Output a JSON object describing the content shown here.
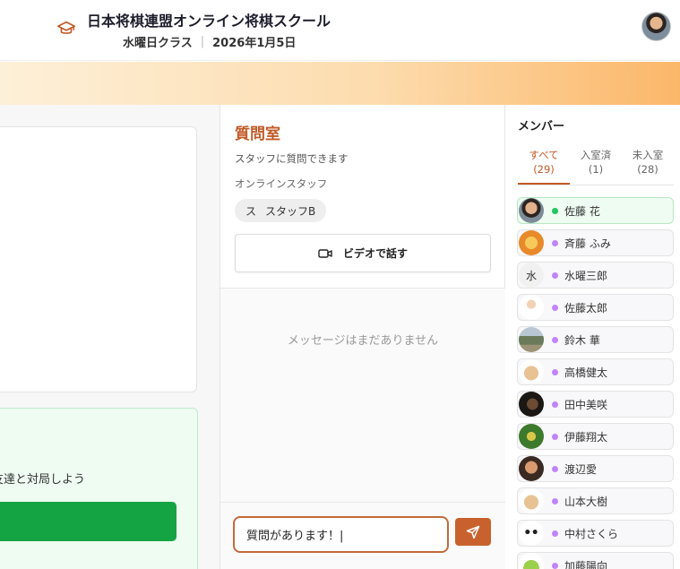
{
  "header": {
    "title": "日本将棋連盟オンライン将棋スクール",
    "class_name": "水曜日クラス",
    "separator": "|",
    "date": "2026年1月5日",
    "icon": "graduation-cap-icon",
    "accent": "#c25a26"
  },
  "left": {
    "green_text": "友達と対局しよう"
  },
  "question_room": {
    "title": "質問室",
    "description": "スタッフに質問できます",
    "online_staff_label": "オンラインスタッフ",
    "staff": [
      {
        "initial": "ス",
        "name": "スタッフB"
      }
    ],
    "video_button_label": "ビデオで話す",
    "empty_message": "メッセージはまだありません",
    "input_value": "質問があります！|",
    "send_icon": "send-icon"
  },
  "members": {
    "title": "メンバー",
    "tabs": [
      {
        "label": "すべて",
        "count": "(29)",
        "active": true
      },
      {
        "label": "入室済",
        "count": "(1)",
        "active": false
      },
      {
        "label": "未入室",
        "count": "(28)",
        "active": false
      }
    ],
    "status_colors": {
      "online": "#22c55e",
      "offline": "#c084fc"
    },
    "list": [
      {
        "name": "佐藤 花",
        "online": true,
        "avatar": "photo-woman",
        "initial": ""
      },
      {
        "name": "斉藤 ふみ",
        "online": false,
        "avatar": "lion",
        "initial": ""
      },
      {
        "name": "水曜三郎",
        "online": false,
        "avatar": "initial",
        "initial": "水"
      },
      {
        "name": "佐藤太郎",
        "online": false,
        "avatar": "doctor",
        "initial": ""
      },
      {
        "name": "鈴木 華",
        "online": false,
        "avatar": "landscape",
        "initial": ""
      },
      {
        "name": "高橋健太",
        "online": false,
        "avatar": "bear",
        "initial": ""
      },
      {
        "name": "田中美咲",
        "online": false,
        "avatar": "dark-photo",
        "initial": ""
      },
      {
        "name": "伊藤翔太",
        "online": false,
        "avatar": "green-photo",
        "initial": ""
      },
      {
        "name": "渡辺愛",
        "online": false,
        "avatar": "man-photo",
        "initial": ""
      },
      {
        "name": "山本大樹",
        "online": false,
        "avatar": "bear",
        "initial": ""
      },
      {
        "name": "中村さくら",
        "online": false,
        "avatar": "panda",
        "initial": ""
      },
      {
        "name": "加藤陽向",
        "online": false,
        "avatar": "frog",
        "initial": ""
      }
    ]
  }
}
